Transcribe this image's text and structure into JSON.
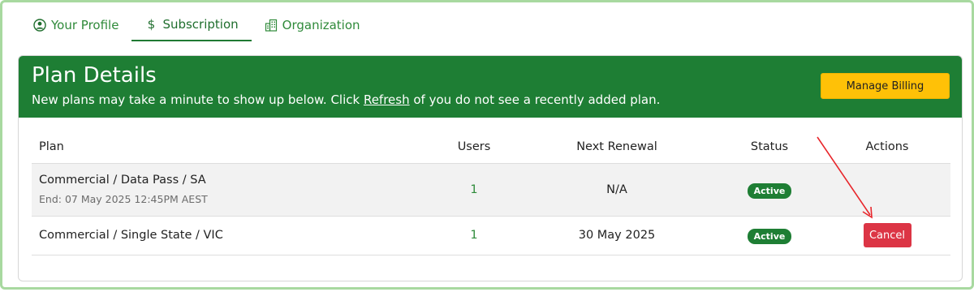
{
  "tabs": [
    {
      "label": "Your Profile",
      "icon": "user-circle-icon"
    },
    {
      "label": "Subscription",
      "icon": "dollar-icon"
    },
    {
      "label": "Organization",
      "icon": "building-icon"
    }
  ],
  "active_tab": "Subscription",
  "plan_details": {
    "title": "Plan Details",
    "subtitle_before": "New plans may take a minute to show up below. Click ",
    "refresh_link": "Refresh",
    "subtitle_after": " of you do not see a recently added plan.",
    "manage_billing_label": "Manage Billing"
  },
  "table": {
    "headers": [
      "Plan",
      "Users",
      "Next Renewal",
      "Status",
      "Actions"
    ],
    "rows": [
      {
        "plan": "Commercial / Data Pass / SA",
        "plan_sub": "End: 07 May 2025 12:45PM AEST",
        "users": "1",
        "next_renewal": "N/A",
        "status": "Active",
        "action": ""
      },
      {
        "plan": "Commercial / Single State / VIC",
        "plan_sub": "",
        "users": "1",
        "next_renewal": "30 May 2025",
        "status": "Active",
        "action": "Cancel"
      }
    ]
  },
  "colors": {
    "header_green": "#1e7e34",
    "billing_yellow": "#ffc107",
    "cancel_red": "#dc3545",
    "annotation_arrow": "#e8262b"
  }
}
